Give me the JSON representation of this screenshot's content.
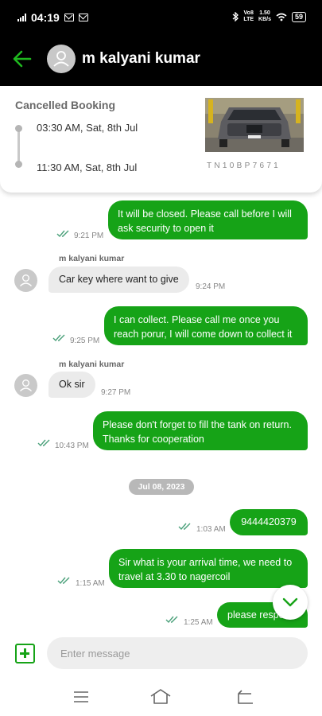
{
  "status_bar": {
    "time": "04:19",
    "network_label_top": "Vo8",
    "network_label_bottom": "LTE",
    "speed_top": "1.50",
    "speed_bottom": "KB/s",
    "battery": "59"
  },
  "header": {
    "contact_name": "m kalyani kumar",
    "back_icon": "arrow-left-icon",
    "avatar_icon": "person-icon"
  },
  "booking": {
    "status": "Cancelled Booking",
    "start_time": "03:30 AM, Sat, 8th Jul",
    "end_time": "11:30 AM, Sat, 8th Jul",
    "car_plate": "TN10BP7671"
  },
  "messages": [
    {
      "direction": "out",
      "text": "It will be closed. Please call before I will ask security to open it",
      "time": "9:21 PM"
    },
    {
      "direction": "in",
      "sender": "m kalyani kumar",
      "text": "Car key where want to give",
      "time": "9:24 PM"
    },
    {
      "direction": "out",
      "text": "I can collect. Please call me once you reach porur, I will come down to collect it",
      "time": "9:25 PM"
    },
    {
      "direction": "in",
      "sender": "m kalyani kumar",
      "text": "Ok sir",
      "time": "9:27 PM"
    },
    {
      "direction": "out",
      "text": "Please don't forget to fill the tank on return. Thanks for cooperation",
      "time": "10:43 PM"
    },
    {
      "direction": "out",
      "text": "9444420379",
      "time": "1:03 AM"
    },
    {
      "direction": "out",
      "text": "Sir what is your arrival time, we need to travel at 3.30 to nagercoil",
      "time": "1:15 AM"
    },
    {
      "direction": "out",
      "text": "please respo",
      "time": "1:25 AM"
    }
  ],
  "date_separator": "Jul 08, 2023",
  "composer": {
    "placeholder": "Enter message",
    "add_icon": "plus-square-icon"
  },
  "colors": {
    "accent_green": "#16a317",
    "header_bg": "#000000",
    "incoming_bubble": "#ebebeb",
    "tick_color": "#4aa07a"
  }
}
